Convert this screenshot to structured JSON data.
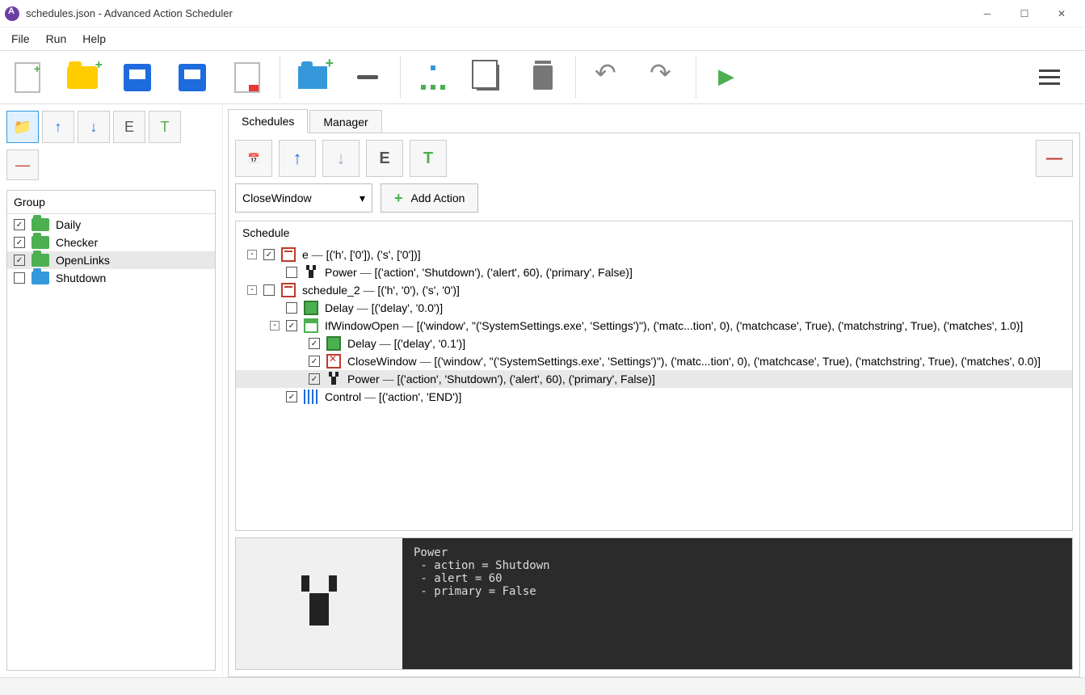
{
  "titlebar": {
    "title": "schedules.json - Advanced Action Scheduler"
  },
  "menu": {
    "file": "File",
    "run": "Run",
    "help": "Help"
  },
  "sidebar": {
    "group_label": "Group",
    "items": [
      {
        "label": "Daily",
        "checked": true,
        "color": "green",
        "selected": false
      },
      {
        "label": "Checker",
        "checked": true,
        "color": "green",
        "selected": false
      },
      {
        "label": "OpenLinks",
        "checked": true,
        "color": "green",
        "selected": true
      },
      {
        "label": "Shutdown",
        "checked": false,
        "color": "blue",
        "selected": false
      }
    ]
  },
  "tabs": {
    "schedules": "Schedules",
    "manager": "Manager"
  },
  "sch_toolbar": {
    "E": "E",
    "T": "T",
    "minus": "—"
  },
  "action": {
    "selected": "CloseWindow",
    "add_label": "Add Action"
  },
  "tree": {
    "header": "Schedule",
    "rows": [
      {
        "indent": 0,
        "toggle": "-",
        "checked": true,
        "icon": "calendar",
        "name": "e",
        "params": "[('h', ['0']), ('s', ['0'])]",
        "selected": false
      },
      {
        "indent": 1,
        "toggle": "",
        "checked": false,
        "icon": "power",
        "name": "Power",
        "params": "[('action', 'Shutdown'), ('alert', 60), ('primary', False)]",
        "selected": false
      },
      {
        "indent": 0,
        "toggle": "-",
        "checked": false,
        "icon": "calendar",
        "name": "schedule_2",
        "params": "[('h', '0'), ('s', '0')]",
        "selected": false
      },
      {
        "indent": 1,
        "toggle": "",
        "checked": false,
        "icon": "delay",
        "name": "Delay",
        "params": "[('delay', '0.0')]",
        "selected": false
      },
      {
        "indent": 1,
        "toggle": "-",
        "checked": true,
        "icon": "window",
        "name": "IfWindowOpen",
        "params": "[('window', \"('SystemSettings.exe', 'Settings')\"), ('matc...tion', 0), ('matchcase', True), ('matchstring', True), ('matches', 1.0)]",
        "selected": false
      },
      {
        "indent": 2,
        "toggle": "",
        "checked": true,
        "icon": "delay",
        "name": "Delay",
        "params": "[('delay', '0.1')]",
        "selected": false
      },
      {
        "indent": 2,
        "toggle": "",
        "checked": true,
        "icon": "close",
        "name": "CloseWindow",
        "params": "[('window', \"('SystemSettings.exe', 'Settings')\"), ('matc...tion', 0), ('matchcase', True), ('matchstring', True), ('matches', 0.0)]",
        "selected": false
      },
      {
        "indent": 2,
        "toggle": "",
        "checked": true,
        "icon": "power",
        "name": "Power",
        "params": "[('action', 'Shutdown'), ('alert', 60), ('primary', False)]",
        "selected": true
      },
      {
        "indent": 1,
        "toggle": "",
        "checked": true,
        "icon": "control",
        "name": "Control",
        "params": "[('action', 'END')]",
        "selected": false
      }
    ]
  },
  "details": {
    "text": "Power\n - action = Shutdown\n - alert = 60\n - primary = False"
  }
}
